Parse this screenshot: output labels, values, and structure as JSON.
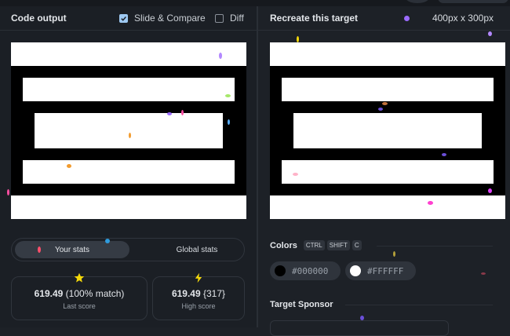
{
  "left_panel": {
    "title": "Code output",
    "slide_compare_label": "Slide & Compare",
    "slide_compare_checked": true,
    "diff_label": "Diff",
    "diff_checked": false
  },
  "right_panel": {
    "title": "Recreate this target",
    "size": "400px x 300px"
  },
  "stats": {
    "tabs": [
      "Your stats",
      "Global stats"
    ],
    "active_tab": "Your stats",
    "last_score": {
      "value": "619.49",
      "extra": "(100% match)",
      "label": "Last score",
      "icon": "star-icon"
    },
    "high_score": {
      "value": "619.49",
      "extra": "{317}",
      "label": "High score",
      "icon": "lightning-icon"
    }
  },
  "colors": {
    "title": "Colors",
    "shortcut_keys": [
      "CTRL",
      "SHIFT",
      "C"
    ],
    "swatches": [
      {
        "hex": "#000000",
        "label": "#000000"
      },
      {
        "hex": "#FFFFFF",
        "label": "#FFFFFF"
      }
    ]
  },
  "sponsor": {
    "title": "Target Sponsor"
  },
  "theme": {
    "accent": "#9ec9f2",
    "star_color": "#f5d90a",
    "lightning_color": "#f5d90a"
  }
}
